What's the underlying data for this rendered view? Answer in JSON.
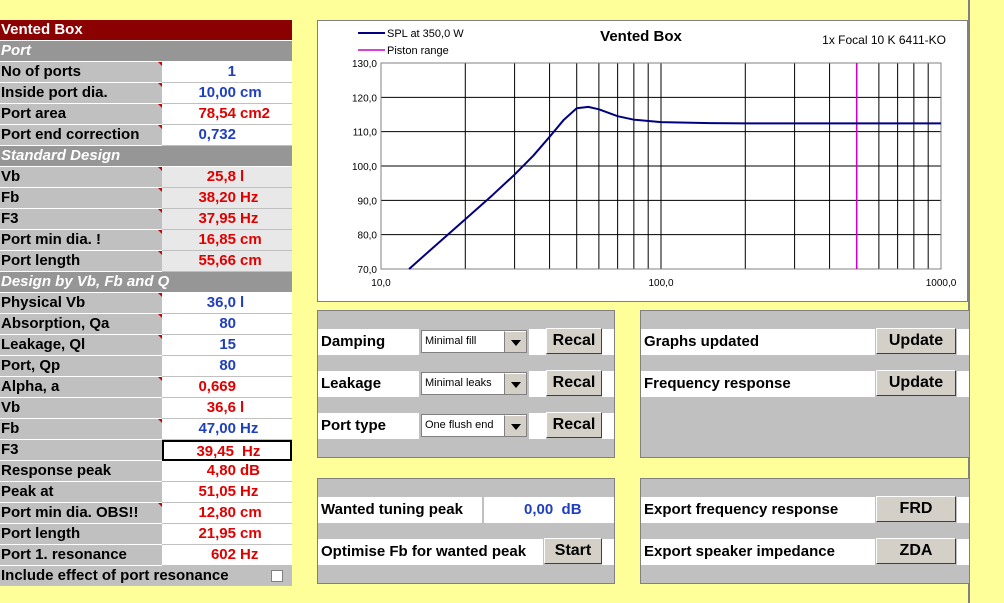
{
  "left_table": {
    "title": "Vented Box",
    "sections": {
      "port": "Port",
      "standard": "Standard Design",
      "vbfbq": "Design by Vb, Fb and Q"
    },
    "rows": [
      {
        "label": "No of ports",
        "value": "1",
        "unit": ""
      },
      {
        "label": "Inside port dia.",
        "value": "10,00",
        "unit": "cm"
      },
      {
        "label": "Port area",
        "value": "78,54",
        "unit": "cm2"
      },
      {
        "label": "Port end correction",
        "value": "0,732",
        "unit": ""
      },
      {
        "label": "Vb",
        "value": "25,8",
        "unit": "l"
      },
      {
        "label": "Fb",
        "value": "38,20",
        "unit": "Hz"
      },
      {
        "label": "F3",
        "value": "37,95",
        "unit": "Hz"
      },
      {
        "label": "Port min dia. !",
        "value": "16,85",
        "unit": "cm"
      },
      {
        "label": "Port length",
        "value": "55,66",
        "unit": "cm"
      },
      {
        "label": "Physical Vb",
        "value": "36,0",
        "unit": "l"
      },
      {
        "label": "Absorption, Qa",
        "value": "80",
        "unit": ""
      },
      {
        "label": "Leakage, Ql",
        "value": "15",
        "unit": ""
      },
      {
        "label": "Port, Qp",
        "value": "80",
        "unit": ""
      },
      {
        "label": "Alpha, a",
        "value": "0,669",
        "unit": ""
      },
      {
        "label": "Vb",
        "value": "36,6",
        "unit": "l"
      },
      {
        "label": "Fb",
        "value": "47,00",
        "unit": "Hz"
      },
      {
        "label": "F3",
        "value": "39,45",
        "unit": "Hz"
      },
      {
        "label": "Response peak",
        "value": "4,80",
        "unit": "dB"
      },
      {
        "label": "Peak at",
        "value": "51,05",
        "unit": "Hz"
      },
      {
        "label": "Port min dia. OBS!!",
        "value": "12,80",
        "unit": "cm"
      },
      {
        "label": "Port length",
        "value": "21,95",
        "unit": "cm"
      },
      {
        "label": "Port 1. resonance",
        "value": "602",
        "unit": "Hz"
      }
    ],
    "include_label": "Include effect of port resonance"
  },
  "chart_data": {
    "type": "line",
    "title": "Vented Box",
    "subtitle": "1x Focal 10 K 6411-KO",
    "legend": [
      "SPL at 350,0 W",
      "Piston range"
    ],
    "x_scale": "log",
    "xlim": [
      10,
      1000
    ],
    "ylim": [
      70,
      130
    ],
    "x_ticks": [
      "10,0",
      "100,0",
      "1000,0"
    ],
    "y_ticks": [
      "130,0",
      "120,0",
      "110,0",
      "100,0",
      "90,0",
      "80,0",
      "70,0"
    ],
    "series": [
      {
        "name": "SPL at 350,0 W",
        "x": [
          12.6,
          15,
          20,
          25,
          30,
          35,
          40,
          45,
          50,
          55,
          60,
          70,
          80,
          100,
          150,
          200,
          300,
          500,
          1000
        ],
        "y": [
          70.0,
          75.5,
          84.5,
          91.5,
          97.5,
          103.0,
          108.5,
          113.5,
          116.8,
          117.2,
          116.5,
          114.5,
          113.5,
          112.8,
          112.5,
          112.4,
          112.4,
          112.4,
          112.4
        ]
      },
      {
        "name": "Piston range",
        "x": [
          500,
          500
        ],
        "y": [
          70,
          130
        ]
      }
    ],
    "colors": {
      "spl": "#000080",
      "piston": "#cc00cc"
    }
  },
  "panel1": {
    "rows": [
      {
        "label": "Damping",
        "option": "Minimal fill",
        "button": "Recal"
      },
      {
        "label": "Leakage",
        "option": "Minimal leaks",
        "button": "Recal"
      },
      {
        "label": "Port type",
        "option": "One flush end",
        "button": "Recal"
      }
    ]
  },
  "panel2": {
    "rows": [
      {
        "label": "Graphs updated",
        "button": "Update"
      },
      {
        "label": "Frequency response",
        "button": "Update"
      }
    ]
  },
  "panel3": {
    "tuning_label": "Wanted tuning peak",
    "tuning_value": "0,00",
    "tuning_unit": "dB",
    "optimise_label": "Optimise Fb for wanted peak",
    "start_button": "Start"
  },
  "panel4": {
    "rows": [
      {
        "label": "Export frequency response",
        "button": "FRD"
      },
      {
        "label": "Export speaker impedance",
        "button": "ZDA"
      }
    ]
  }
}
